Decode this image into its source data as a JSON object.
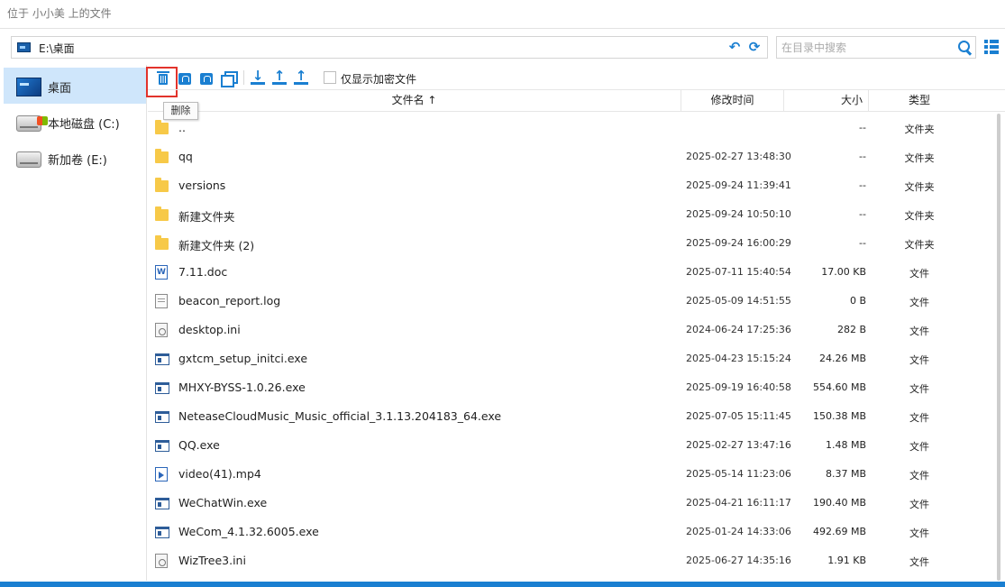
{
  "window": {
    "title": "位于 小小美 上的文件"
  },
  "path": {
    "value": "E:\\桌面"
  },
  "search": {
    "placeholder": "在目录中搜索"
  },
  "sidebar": {
    "items": [
      {
        "label": "桌面",
        "icon": "desktop-icon",
        "active": true
      },
      {
        "label": "本地磁盘 (C:)",
        "icon": "system-drive-icon"
      },
      {
        "label": "新加卷 (E:)",
        "icon": "drive-icon"
      }
    ]
  },
  "toolbar": {
    "buttons": [
      "delete",
      "encrypt",
      "decrypt",
      "copy",
      "download",
      "upload",
      "upload-folder"
    ],
    "checkbox_label": "仅显示加密文件",
    "tooltip": "删除"
  },
  "table": {
    "headers": {
      "name": "文件名 ↑",
      "mtime": "修改时间",
      "size": "大小",
      "type": "类型"
    },
    "rows": [
      {
        "name": "..",
        "mtime": "",
        "size": "--",
        "type": "文件夹",
        "icon": "folder"
      },
      {
        "name": "qq",
        "mtime": "2025-02-27 13:48:30",
        "size": "--",
        "type": "文件夹",
        "icon": "folder"
      },
      {
        "name": "versions",
        "mtime": "2025-09-24 11:39:41",
        "size": "--",
        "type": "文件夹",
        "icon": "folder"
      },
      {
        "name": "新建文件夹",
        "mtime": "2025-09-24 10:50:10",
        "size": "--",
        "type": "文件夹",
        "icon": "folder"
      },
      {
        "name": "新建文件夹 (2)",
        "mtime": "2025-09-24 16:00:29",
        "size": "--",
        "type": "文件夹",
        "icon": "folder"
      },
      {
        "name": "7.11.doc",
        "mtime": "2025-07-11 15:40:54",
        "size": "17.00 KB",
        "type": "文件",
        "icon": "doc"
      },
      {
        "name": "beacon_report.log",
        "mtime": "2025-05-09 14:51:55",
        "size": "0 B",
        "type": "文件",
        "icon": "file"
      },
      {
        "name": "desktop.ini",
        "mtime": "2024-06-24 17:25:36",
        "size": "282 B",
        "type": "文件",
        "icon": "ini"
      },
      {
        "name": "gxtcm_setup_initci.exe",
        "mtime": "2025-04-23 15:15:24",
        "size": "24.26 MB",
        "type": "文件",
        "icon": "exe"
      },
      {
        "name": "MHXY-BYSS-1.0.26.exe",
        "mtime": "2025-09-19 16:40:58",
        "size": "554.60 MB",
        "type": "文件",
        "icon": "exe"
      },
      {
        "name": "NeteaseCloudMusic_Music_official_3.1.13.204183_64.exe",
        "mtime": "2025-07-05 15:11:45",
        "size": "150.38 MB",
        "type": "文件",
        "icon": "exe"
      },
      {
        "name": "QQ.exe",
        "mtime": "2025-02-27 13:47:16",
        "size": "1.48 MB",
        "type": "文件",
        "icon": "exe"
      },
      {
        "name": "video(41).mp4",
        "mtime": "2025-05-14 11:23:06",
        "size": "8.37 MB",
        "type": "文件",
        "icon": "video"
      },
      {
        "name": "WeChatWin.exe",
        "mtime": "2025-04-21 16:11:17",
        "size": "190.40 MB",
        "type": "文件",
        "icon": "exe"
      },
      {
        "name": "WeCom_4.1.32.6005.exe",
        "mtime": "2025-01-24 14:33:06",
        "size": "492.69 MB",
        "type": "文件",
        "icon": "exe"
      },
      {
        "name": "WizTree3.ini",
        "mtime": "2025-06-27 14:35:16",
        "size": "1.91 KB",
        "type": "文件",
        "icon": "ini"
      }
    ]
  },
  "colors": {
    "accent": "#1a7fd1",
    "highlight": "#e2332b",
    "selection": "#cfe6fb"
  }
}
